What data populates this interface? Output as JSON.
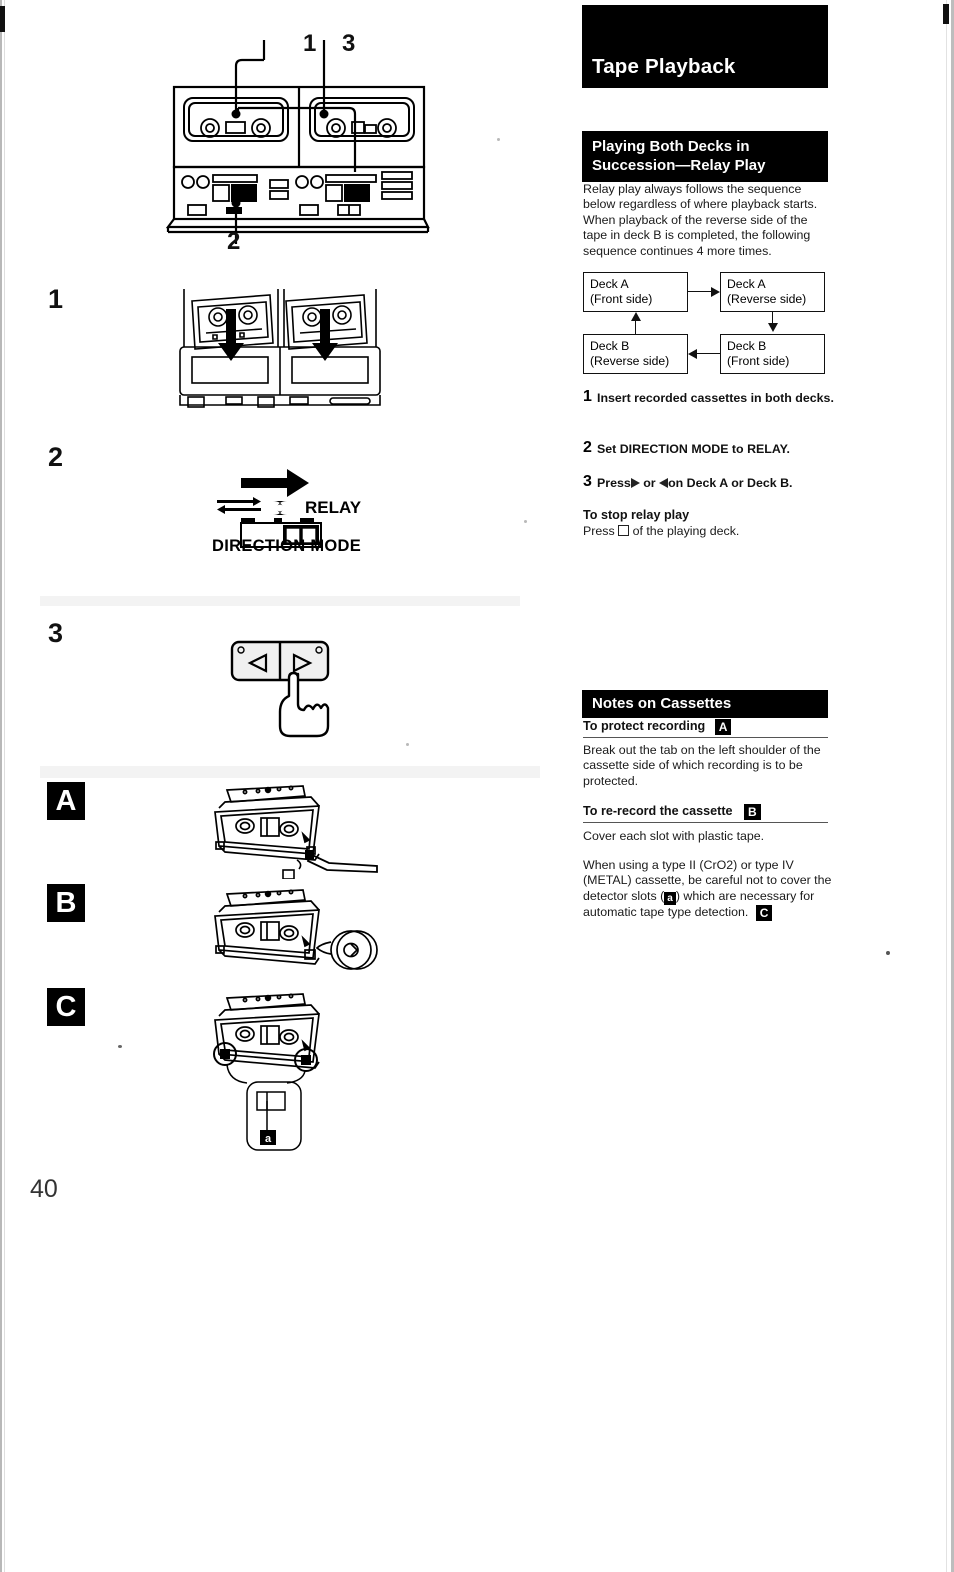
{
  "page": {
    "number": "40",
    "section_title": "Tape Playback"
  },
  "relay": {
    "heading_line1": "Playing Both Decks in",
    "heading_line2": "Succession—Relay Play",
    "intro": "Relay play always follows the sequence below regardless of where playback starts. When playback of the reverse side of the tape in deck B is completed, the following sequence continues 4 more times.",
    "flow": {
      "boxes": [
        {
          "id": "a-front",
          "line1": "Deck A",
          "line2": "(Front side)"
        },
        {
          "id": "a-reverse",
          "line1": "Deck A",
          "line2": "(Reverse side)"
        },
        {
          "id": "b-reverse",
          "line1": "Deck B",
          "line2": "(Reverse side)"
        },
        {
          "id": "b-front",
          "line1": "Deck B",
          "line2": "(Front side)"
        }
      ]
    },
    "steps": [
      {
        "num": "1",
        "text": "Insert recorded cassettes in both decks."
      },
      {
        "num": "2",
        "text": "Set DIRECTION MODE to RELAY."
      },
      {
        "num": "3",
        "text_before": "Press",
        "text_mid": "or",
        "text_after": "on Deck A or Deck B."
      }
    ],
    "stop": {
      "heading": "To stop relay play",
      "text_before": "Press",
      "text_after": "of the playing deck."
    }
  },
  "notes": {
    "heading": "Notes on Cassettes",
    "protect": {
      "heading": "To protect recording",
      "badge": "A",
      "text": "Break out the tab on the left shoulder of the cassette side of which recording is to be protected."
    },
    "rerecord": {
      "heading": "To re-record the cassette",
      "badge": "B",
      "text": "Cover each slot with plastic tape."
    },
    "detector": {
      "part1": "When using a type II (CrO2) or type IV (METAL) cassette, be careful not to cover the detector slots (",
      "slot_badge": "a",
      "part2": ") which are necessary for automatic tape type detection.",
      "badge": "C"
    }
  },
  "left_column": {
    "callouts": [
      "1",
      "3",
      "2"
    ],
    "steps": [
      "1",
      "2",
      "3"
    ],
    "letters": [
      "A",
      "B",
      "C"
    ],
    "direction_mode": {
      "label": "DIRECTION MODE",
      "relay_label": "RELAY"
    },
    "slot_label": "a"
  },
  "colors": {
    "ink": "#000000",
    "paper": "#ffffff",
    "banner_bg": "#000000",
    "banner_fg": "#ffffff"
  }
}
